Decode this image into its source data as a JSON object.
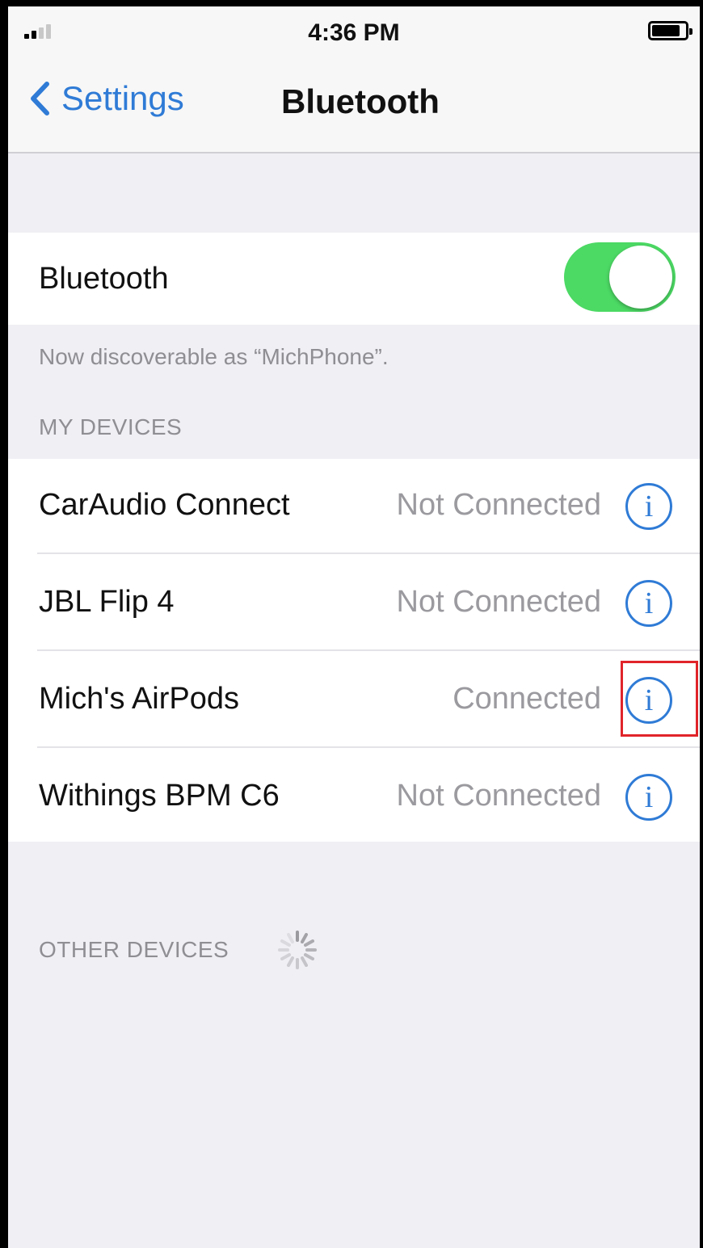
{
  "status_bar": {
    "time": "4:36 PM"
  },
  "nav": {
    "back_label": "Settings",
    "title": "Bluetooth"
  },
  "bluetooth": {
    "label": "Bluetooth",
    "enabled": true,
    "discoverable_text": "Now discoverable as “MichPhone”."
  },
  "sections": {
    "my_devices": "MY DEVICES",
    "other_devices": "OTHER DEVICES"
  },
  "devices": [
    {
      "name": "CarAudio Connect",
      "status": "Not Connected"
    },
    {
      "name": "JBL Flip 4",
      "status": "Not Connected"
    },
    {
      "name": "Mich's AirPods",
      "status": "Connected"
    },
    {
      "name": "Withings BPM C6",
      "status": "Not Connected"
    }
  ],
  "info_glyph": "i",
  "colors": {
    "accent": "#2f7bd6",
    "toggle_on": "#4cd964",
    "highlight": "#e0242a",
    "background": "#efeff4"
  },
  "highlighted_device_index": 2
}
